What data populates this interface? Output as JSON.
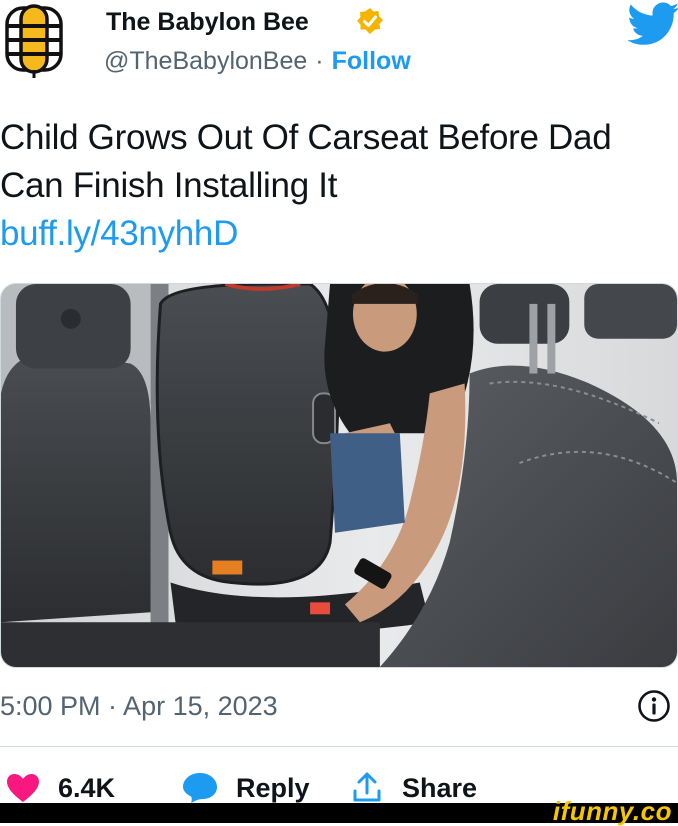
{
  "header": {
    "author_name": "The Babylon Bee",
    "handle": "@TheBabylonBee",
    "separator": "·",
    "follow_label": "Follow",
    "verified_color": "#f4b400",
    "brand_color": "#1d9bf0",
    "avatar_icon": "bee-logo-icon",
    "platform_icon": "twitter-bird-icon"
  },
  "tweet": {
    "text": "Child Grows Out Of Carseat Before Dad Can Finish Installing It",
    "link": "buff.ly/43nyhhD"
  },
  "meta": {
    "timestamp": "5:00 PM · Apr 15, 2023"
  },
  "actions": {
    "like_count": "6.4K",
    "reply_label": "Reply",
    "share_label": "Share",
    "like_color": "#f91880",
    "reply_color": "#1d9bf0"
  },
  "watermark": {
    "text": "ifunny.co"
  }
}
